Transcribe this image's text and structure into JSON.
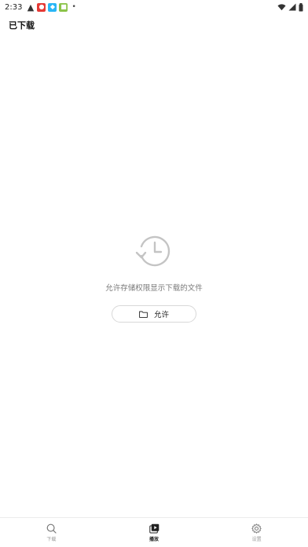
{
  "status_bar": {
    "time": "2:33",
    "notifications": [
      "warning-icon",
      "app-red-icon",
      "app-blue-icon",
      "app-green-icon"
    ],
    "dot": "•",
    "right_icons": [
      "wifi-icon",
      "signal-icon",
      "battery-icon"
    ]
  },
  "header": {
    "title": "已下载"
  },
  "empty_state": {
    "message": "允许存储权限显示下载的文件",
    "button_label": "允许",
    "button_icon": "folder-icon"
  },
  "bottom_nav": {
    "items": [
      {
        "label": "下载",
        "icon": "search-icon",
        "active": false
      },
      {
        "label": "播放",
        "icon": "play-library-icon",
        "active": true
      },
      {
        "label": "设置",
        "icon": "gear-icon",
        "active": false
      }
    ]
  },
  "colors": {
    "active": "#222222",
    "inactive": "#9a9a9a",
    "icon_gray": "#c4c4c4"
  }
}
